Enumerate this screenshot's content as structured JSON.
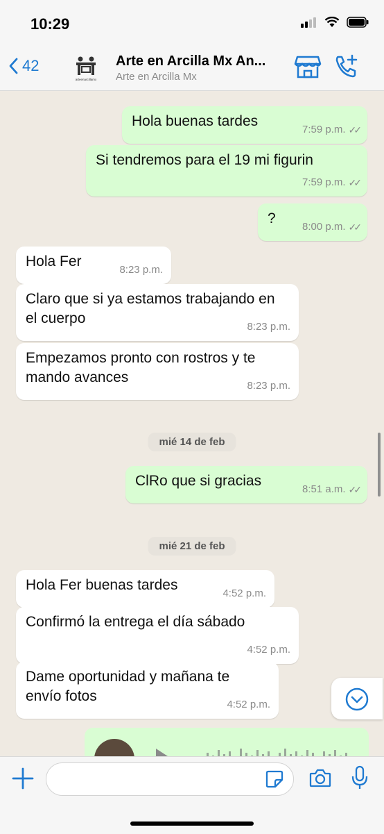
{
  "status_bar": {
    "time": "10:29"
  },
  "header": {
    "back_count": "42",
    "title": "Arte en Arcilla Mx An...",
    "subtitle": "Arte en Arcilla Mx",
    "avatar_caption": "arteenarcillamx"
  },
  "messages": [
    {
      "text": "Hola buenas tardes",
      "time": "7:59 p.m.",
      "dir": "out"
    },
    {
      "text": "Si tendremos para el 19 mi figurin",
      "time": "7:59 p.m.",
      "dir": "out"
    },
    {
      "text": "?",
      "time": "8:00 p.m.",
      "dir": "out"
    },
    {
      "text": "Hola Fer",
      "time": "8:23 p.m.",
      "dir": "in"
    },
    {
      "text": "Claro que si ya estamos trabajando en el cuerpo",
      "time": "8:23 p.m.",
      "dir": "in"
    },
    {
      "text": "Empezamos pronto con rostros y te mando avances",
      "time": "8:23 p.m.",
      "dir": "in"
    },
    {
      "text": "ClRo que si gracias",
      "time": "8:51 a.m.",
      "dir": "out"
    },
    {
      "text": "Hola Fer buenas tardes",
      "time": "4:52 p.m.",
      "dir": "in"
    },
    {
      "text": "Confirmó la entrega el día sábado",
      "time": "4:52 p.m.",
      "dir": "in"
    },
    {
      "text": "Dame oportunidad y mañana te envío fotos",
      "time": "4:52 p.m.",
      "dir": "in"
    }
  ],
  "date_separators": [
    "mié 14 de feb",
    "mié 21 de feb"
  ],
  "icons": {
    "back": "chevron-left-icon",
    "store": "store-icon",
    "call": "phone-plus-icon",
    "scroll": "chevron-down-icon",
    "attach": "plus-icon",
    "sticker": "sticker-icon",
    "camera": "camera-icon",
    "mic": "microphone-icon"
  },
  "colors": {
    "accent": "#1f7ad1",
    "outgoing": "#d9fdd3",
    "incoming": "#ffffff",
    "background": "#efeae2"
  }
}
